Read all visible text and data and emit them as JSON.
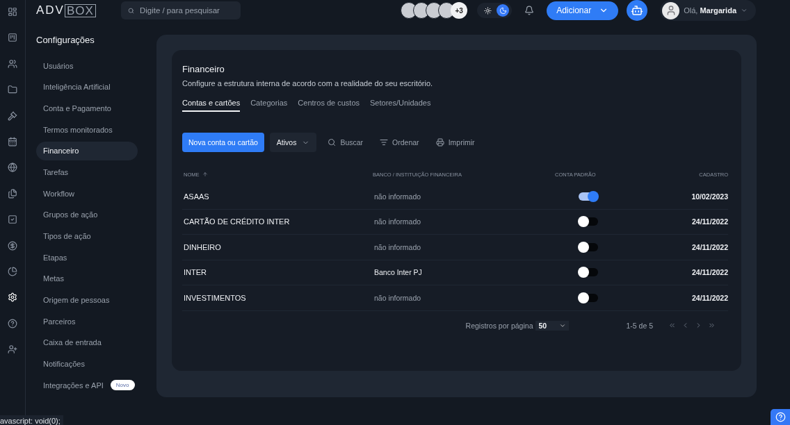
{
  "logo": {
    "left": "ADV",
    "right": "BOX"
  },
  "search": {
    "placeholder": "Digite / para pesquisar"
  },
  "avatars": {
    "more": "+3"
  },
  "theme": {
    "dark": true
  },
  "add_button": "Adicionar",
  "user": {
    "greeting": "Olá,",
    "name": "Margarida"
  },
  "rail": [
    {
      "selected": false
    },
    {
      "selected": false
    },
    {
      "selected": false
    },
    {
      "selected": false
    },
    {
      "selected": false
    },
    {
      "selected": false
    },
    {
      "selected": false
    },
    {
      "selected": false
    },
    {
      "selected": false
    },
    {
      "selected": false
    },
    {
      "selected": false
    },
    {
      "selected": true
    },
    {
      "selected": false
    },
    {
      "selected": false
    }
  ],
  "sidebar": {
    "title": "Configurações",
    "items": [
      {
        "label": "Usuários",
        "selected": false
      },
      {
        "label": "Inteligência Artificial",
        "selected": false
      },
      {
        "label": "Conta e Pagamento",
        "selected": false
      },
      {
        "label": "Termos monitorados",
        "selected": false
      },
      {
        "label": "Financeiro",
        "selected": true
      },
      {
        "label": "Tarefas",
        "selected": false
      },
      {
        "label": "Workflow",
        "selected": false
      },
      {
        "label": "Grupos de ação",
        "selected": false
      },
      {
        "label": "Tipos de ação",
        "selected": false
      },
      {
        "label": "Etapas",
        "selected": false
      },
      {
        "label": "Metas",
        "selected": false
      },
      {
        "label": "Origem de pessoas",
        "selected": false
      },
      {
        "label": "Parceiros",
        "selected": false
      },
      {
        "label": "Caixa de entrada",
        "selected": false
      },
      {
        "label": "Notificações",
        "selected": false
      },
      {
        "label": "Integrações e API",
        "selected": false,
        "badge": "Novo"
      }
    ]
  },
  "section": {
    "title": "Financeiro",
    "description": "Configure a estrutura interna de acordo com a realidade do seu escritório."
  },
  "tabs": [
    {
      "label": "Contas e cartões",
      "selected": true
    },
    {
      "label": "Categorias",
      "selected": false
    },
    {
      "label": "Centros de custos",
      "selected": false
    },
    {
      "label": "Setores/Unidades",
      "selected": false
    }
  ],
  "toolbar": {
    "primary": "Nova conta ou cartão",
    "filter": "Ativos",
    "actions": [
      {
        "label": "Buscar"
      },
      {
        "label": "Ordenar"
      },
      {
        "label": "Imprimir"
      }
    ]
  },
  "table": {
    "columns": [
      "NOME",
      "BANCO / INSTITUIÇÃO FINANCEIRA",
      "CONTA PADRÃO",
      "CADASTRO"
    ],
    "rows": [
      {
        "name": "ASAAS",
        "bank": "não informado",
        "bank_informed": false,
        "default": true,
        "date": "10/02/2023"
      },
      {
        "name": "CARTÃO DE CRÉDITO INTER",
        "bank": "não informado",
        "bank_informed": false,
        "default": false,
        "date": "24/11/2022"
      },
      {
        "name": "DINHEIRO",
        "bank": "não informado",
        "bank_informed": false,
        "default": false,
        "date": "24/11/2022"
      },
      {
        "name": "INTER",
        "bank": "Banco Inter PJ",
        "bank_informed": true,
        "default": false,
        "date": "24/11/2022"
      },
      {
        "name": "INVESTIMENTOS",
        "bank": "não informado",
        "bank_informed": false,
        "default": false,
        "date": "24/11/2022"
      }
    ]
  },
  "pagination": {
    "label": "Registros por página",
    "per_page": "50",
    "range": "1-5 de 5"
  },
  "status_bar": "avascript: void(0);"
}
